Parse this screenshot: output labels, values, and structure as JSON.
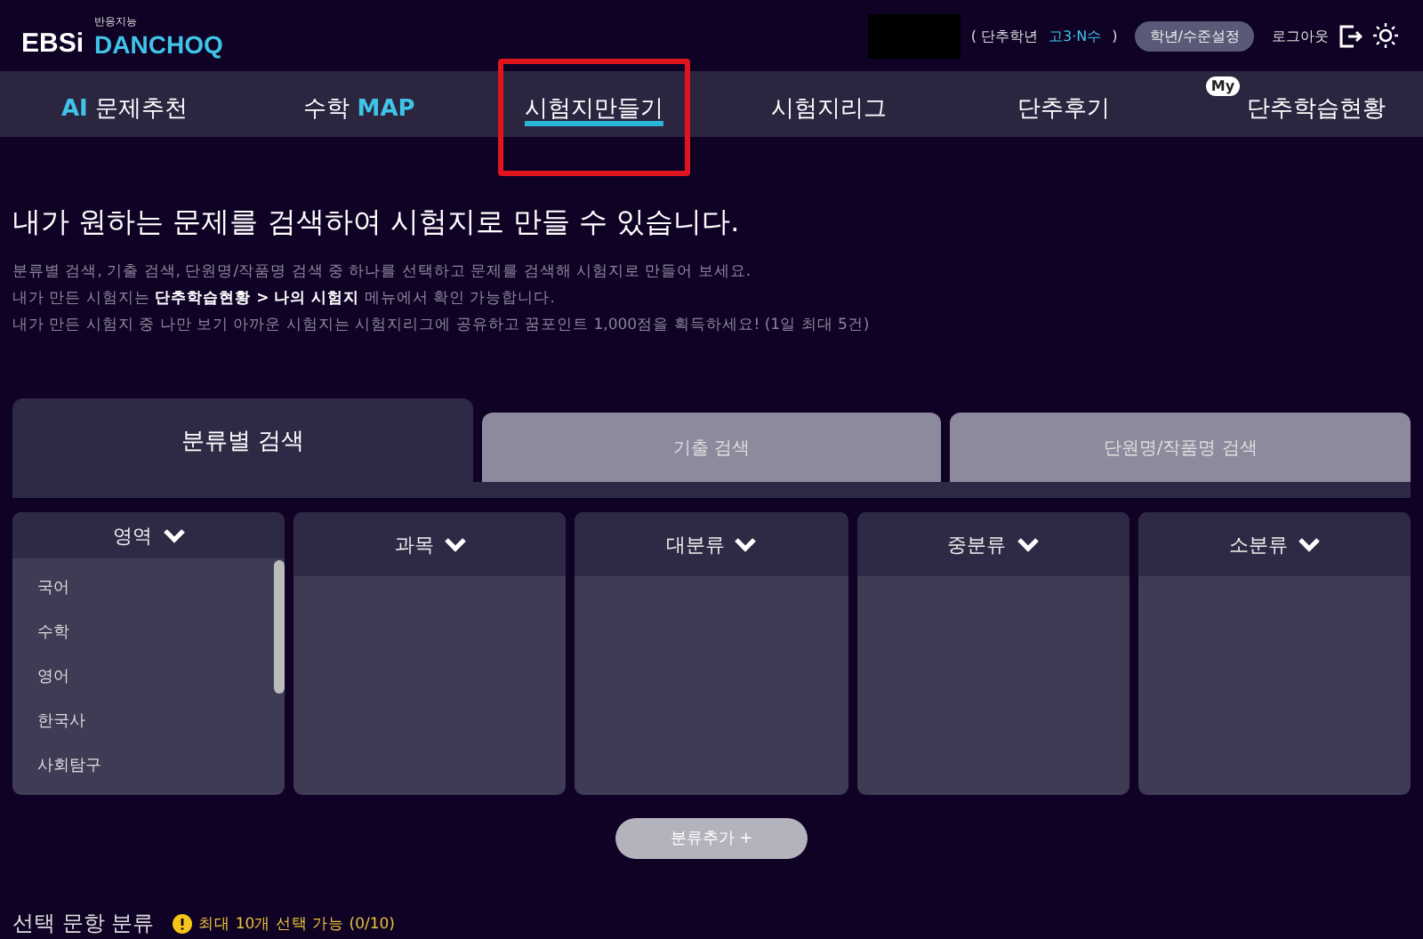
{
  "header": {
    "logo_left": "EBSi",
    "logo_tag": "반응지능",
    "logo_right": "DANCHOQ",
    "grade_label": "( 단추학년",
    "grade_value": "고3·N수",
    "grade_close": ")",
    "settings_button": "학년/수준설정",
    "logout": "로그아웃"
  },
  "nav": [
    {
      "label": "**AI** 문제추천",
      "selected": false,
      "highlighted": false
    },
    {
      "label": "수학 **MAP**",
      "selected": false,
      "highlighted": false
    },
    {
      "label": "시험지만들기",
      "selected": true,
      "highlighted": true
    },
    {
      "label": "시험지리그",
      "selected": false,
      "highlighted": false
    },
    {
      "label": "단추후기",
      "selected": false,
      "highlighted": false
    },
    {
      "label": "단추학습현황",
      "badge": "My",
      "selected": false,
      "highlighted": false
    }
  ],
  "headline": "내가 원하는 문제를 검색하여 시험지로 만들 수 있습니다.",
  "description": [
    "분류별 검색, 기출 검색, 단원명/작품명 검색 중 하나를 선택하고 문제를 검색해 시험지로 만들어 보세요.",
    "내가 만든 시험지는 **단추학습현황 > 나의 시험지** 메뉴에서 확인 가능합니다.",
    "내가 만든 시험지 중 나만 보기 아까운 시험지는 시험지리그에 공유하고 꿈포인트 1,000점을 획득하세요! (1일 최대 5건)"
  ],
  "search_tabs": [
    {
      "label": "분류별 검색",
      "selected": true
    },
    {
      "label": "기출 검색",
      "selected": false
    },
    {
      "label": "단원명/작품명 검색",
      "selected": false
    }
  ],
  "columns": [
    {
      "title": "영역",
      "items": [
        "국어",
        "수학",
        "영어",
        "한국사",
        "사회탐구"
      ]
    },
    {
      "title": "과목"
    },
    {
      "title": "대분류"
    },
    {
      "title": "중분류"
    },
    {
      "title": "소분류"
    }
  ],
  "add_button": "분류추가 +",
  "selection": {
    "title": "선택 문항 분류",
    "notice": "최대 10개 선택 가능 (0/10)"
  }
}
